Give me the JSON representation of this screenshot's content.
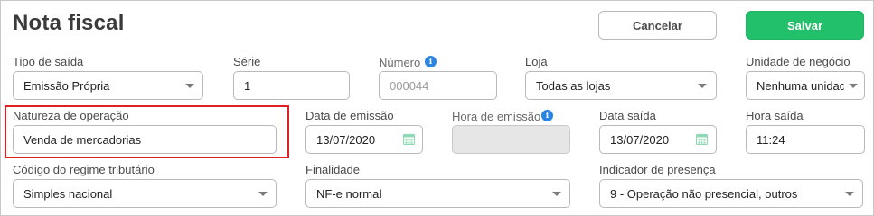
{
  "header": {
    "title": "Nota fiscal",
    "cancel_label": "Cancelar",
    "save_label": "Salvar"
  },
  "colors": {
    "accent_save": "#22c06a",
    "info_icon": "#2b86e3",
    "highlight_border": "#e02020",
    "calendar_icon": "#8fd9b6"
  },
  "row1": {
    "tipo_saida": {
      "label": "Tipo de saída",
      "value": "Emissão Própria"
    },
    "serie": {
      "label": "Série",
      "value": "1"
    },
    "numero": {
      "label": "Número",
      "placeholder": "000044",
      "info_icon": "info-icon"
    },
    "loja": {
      "label": "Loja",
      "value": "Todas as lojas"
    },
    "unidade": {
      "label": "Unidade de negócio",
      "value": "Nenhuma unidade"
    }
  },
  "row2": {
    "natureza": {
      "label": "Natureza de operação",
      "value": "Venda de mercadorias"
    },
    "data_emissao": {
      "label": "Data de emissão",
      "value": "13/07/2020"
    },
    "hora_emissao": {
      "label": "Hora de emissão",
      "value": "",
      "info_icon": "info-icon"
    },
    "data_saida": {
      "label": "Data saída",
      "value": "13/07/2020"
    },
    "hora_saida": {
      "label": "Hora saída",
      "value": "11:24"
    }
  },
  "row3": {
    "regime": {
      "label": "Código do regime tributário",
      "value": "Simples nacional"
    },
    "finalidade": {
      "label": "Finalidade",
      "value": "NF-e normal"
    },
    "presenca": {
      "label": "Indicador de presença",
      "value": "9 - Operação não presencial, outros"
    }
  }
}
